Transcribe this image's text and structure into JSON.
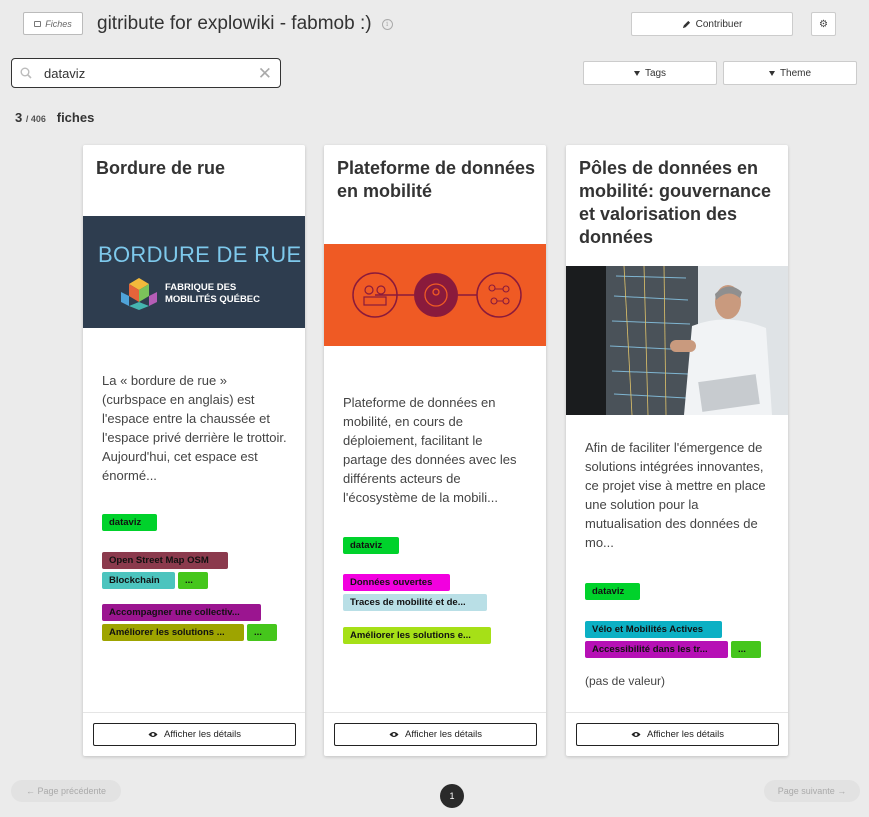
{
  "header": {
    "fiches_label": "Fiches",
    "title": "gitribute for explowiki - fabmob :)",
    "contribute_label": "Contribuer"
  },
  "search": {
    "value": "dataviz",
    "placeholder": ""
  },
  "filters": {
    "tags_label": "Tags",
    "theme_label": "Theme"
  },
  "results": {
    "shown": "3",
    "total": "/ 406",
    "label": "fiches"
  },
  "cards": [
    {
      "title": "Bordure de rue",
      "image_text": "BORDURE DE RUE",
      "image_brand": "FABRIQUE DES MOBILITÉS QUÉBEC",
      "description": "La « bordure de rue » (curbspace en anglais) est l'espace entre la chaussée et l'espace privé derrière le trottoir. Aujourd'hui, cet espace est énormé...",
      "tags": [
        {
          "label": "dataviz",
          "color": "#00d22b"
        },
        {
          "label": "Open Street Map OSM",
          "color": "#8b3a4d"
        },
        {
          "label": "Blockchain",
          "color": "#4cc4be"
        },
        {
          "label": "...",
          "color": "#45c61c"
        },
        {
          "label": "Accompagner une collectiv...",
          "color": "#9b1590"
        },
        {
          "label": "Améliorer les solutions ...",
          "color": "#9ea400"
        },
        {
          "label": "...",
          "color": "#45c61c"
        }
      ],
      "details_label": "Afficher les détails"
    },
    {
      "title": "Plateforme de données en mobilité",
      "description": "Plateforme de données en mobilité, en cours de déploiement, facilitant le partage des données avec les différents acteurs de l'écosystème de la mobili...",
      "tags": [
        {
          "label": "dataviz",
          "color": "#00d22b"
        },
        {
          "label": "Données ouvertes",
          "color": "#f200df"
        },
        {
          "label": "Traces de mobilité et de...",
          "color": "#b9dfe6"
        },
        {
          "label": "Améliorer les solutions e...",
          "color": "#a6e017"
        }
      ],
      "details_label": "Afficher les détails"
    },
    {
      "title": "Pôles de données en mobilité: gouvernance et valorisation des données",
      "description": "Afin de faciliter l'émergence de solutions intégrées innovantes, ce projet vise à mettre en place une solution pour la mutualisation des données de mo...",
      "tags": [
        {
          "label": "dataviz",
          "color": "#00d22b"
        },
        {
          "label": "Vélo et Mobilités Actives",
          "color": "#0cb0c4"
        },
        {
          "label": "Accessibilité dans les tr...",
          "color": "#b610b5"
        },
        {
          "label": "...",
          "color": "#45c61c"
        }
      ],
      "no_value": "(pas de valeur)",
      "details_label": "Afficher les détails"
    }
  ],
  "pagination": {
    "prev_label": "← Page précédente",
    "next_label": "Page suivante →",
    "current_page": "1"
  },
  "colors": {
    "background": "#ebebeb",
    "orange_banner": "#ef5a24",
    "dark_banner": "#2e3d4f",
    "maroon_circle": "#8a1a3c"
  }
}
